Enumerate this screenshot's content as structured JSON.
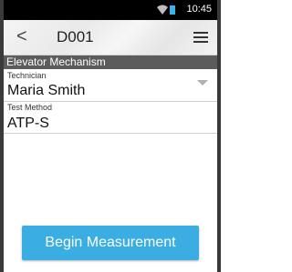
{
  "status_bar": {
    "time": "10:45",
    "icons": [
      "wifi-icon",
      "battery-icon"
    ]
  },
  "action_bar": {
    "back_icon": "chevron-left-icon",
    "title": "D001",
    "menu_icon": "hamburger-menu-icon"
  },
  "section": {
    "header": "Elevator Mechanism"
  },
  "fields": {
    "technician": {
      "label": "Technician",
      "value": "Maria Smith",
      "control": "dropdown"
    },
    "test_method": {
      "label": "Test Method",
      "value": "ATP-S"
    }
  },
  "actions": {
    "begin_label": "Begin Measurement"
  },
  "colors": {
    "accent": "#3aaee3",
    "section_header_bg": "#5c5c5c",
    "status_bar_bg": "#000000"
  }
}
